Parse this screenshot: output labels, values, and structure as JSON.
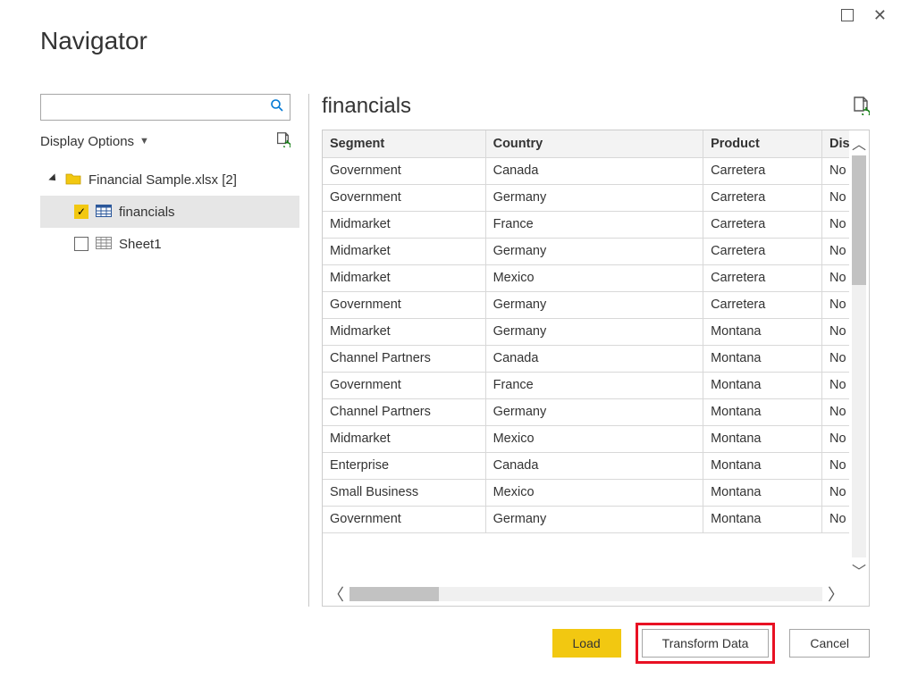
{
  "dialog": {
    "title": "Navigator"
  },
  "search": {
    "value": ""
  },
  "display_options": {
    "label": "Display Options"
  },
  "tree": {
    "root": {
      "label": "Financial Sample.xlsx [2]"
    },
    "children": [
      {
        "label": "financials",
        "checked": true
      },
      {
        "label": "Sheet1",
        "checked": false
      }
    ]
  },
  "preview": {
    "title": "financials",
    "columns": [
      "Segment",
      "Country",
      "Product",
      "Discou"
    ],
    "rows": [
      [
        "Government",
        "Canada",
        "Carretera",
        "No"
      ],
      [
        "Government",
        "Germany",
        "Carretera",
        "No"
      ],
      [
        "Midmarket",
        "France",
        "Carretera",
        "No"
      ],
      [
        "Midmarket",
        "Germany",
        "Carretera",
        "No"
      ],
      [
        "Midmarket",
        "Mexico",
        "Carretera",
        "No"
      ],
      [
        "Government",
        "Germany",
        "Carretera",
        "No"
      ],
      [
        "Midmarket",
        "Germany",
        "Montana",
        "No"
      ],
      [
        "Channel Partners",
        "Canada",
        "Montana",
        "No"
      ],
      [
        "Government",
        "France",
        "Montana",
        "No"
      ],
      [
        "Channel Partners",
        "Germany",
        "Montana",
        "No"
      ],
      [
        "Midmarket",
        "Mexico",
        "Montana",
        "No"
      ],
      [
        "Enterprise",
        "Canada",
        "Montana",
        "No"
      ],
      [
        "Small Business",
        "Mexico",
        "Montana",
        "No"
      ],
      [
        "Government",
        "Germany",
        "Montana",
        "No"
      ]
    ]
  },
  "buttons": {
    "load": "Load",
    "transform": "Transform Data",
    "cancel": "Cancel"
  }
}
